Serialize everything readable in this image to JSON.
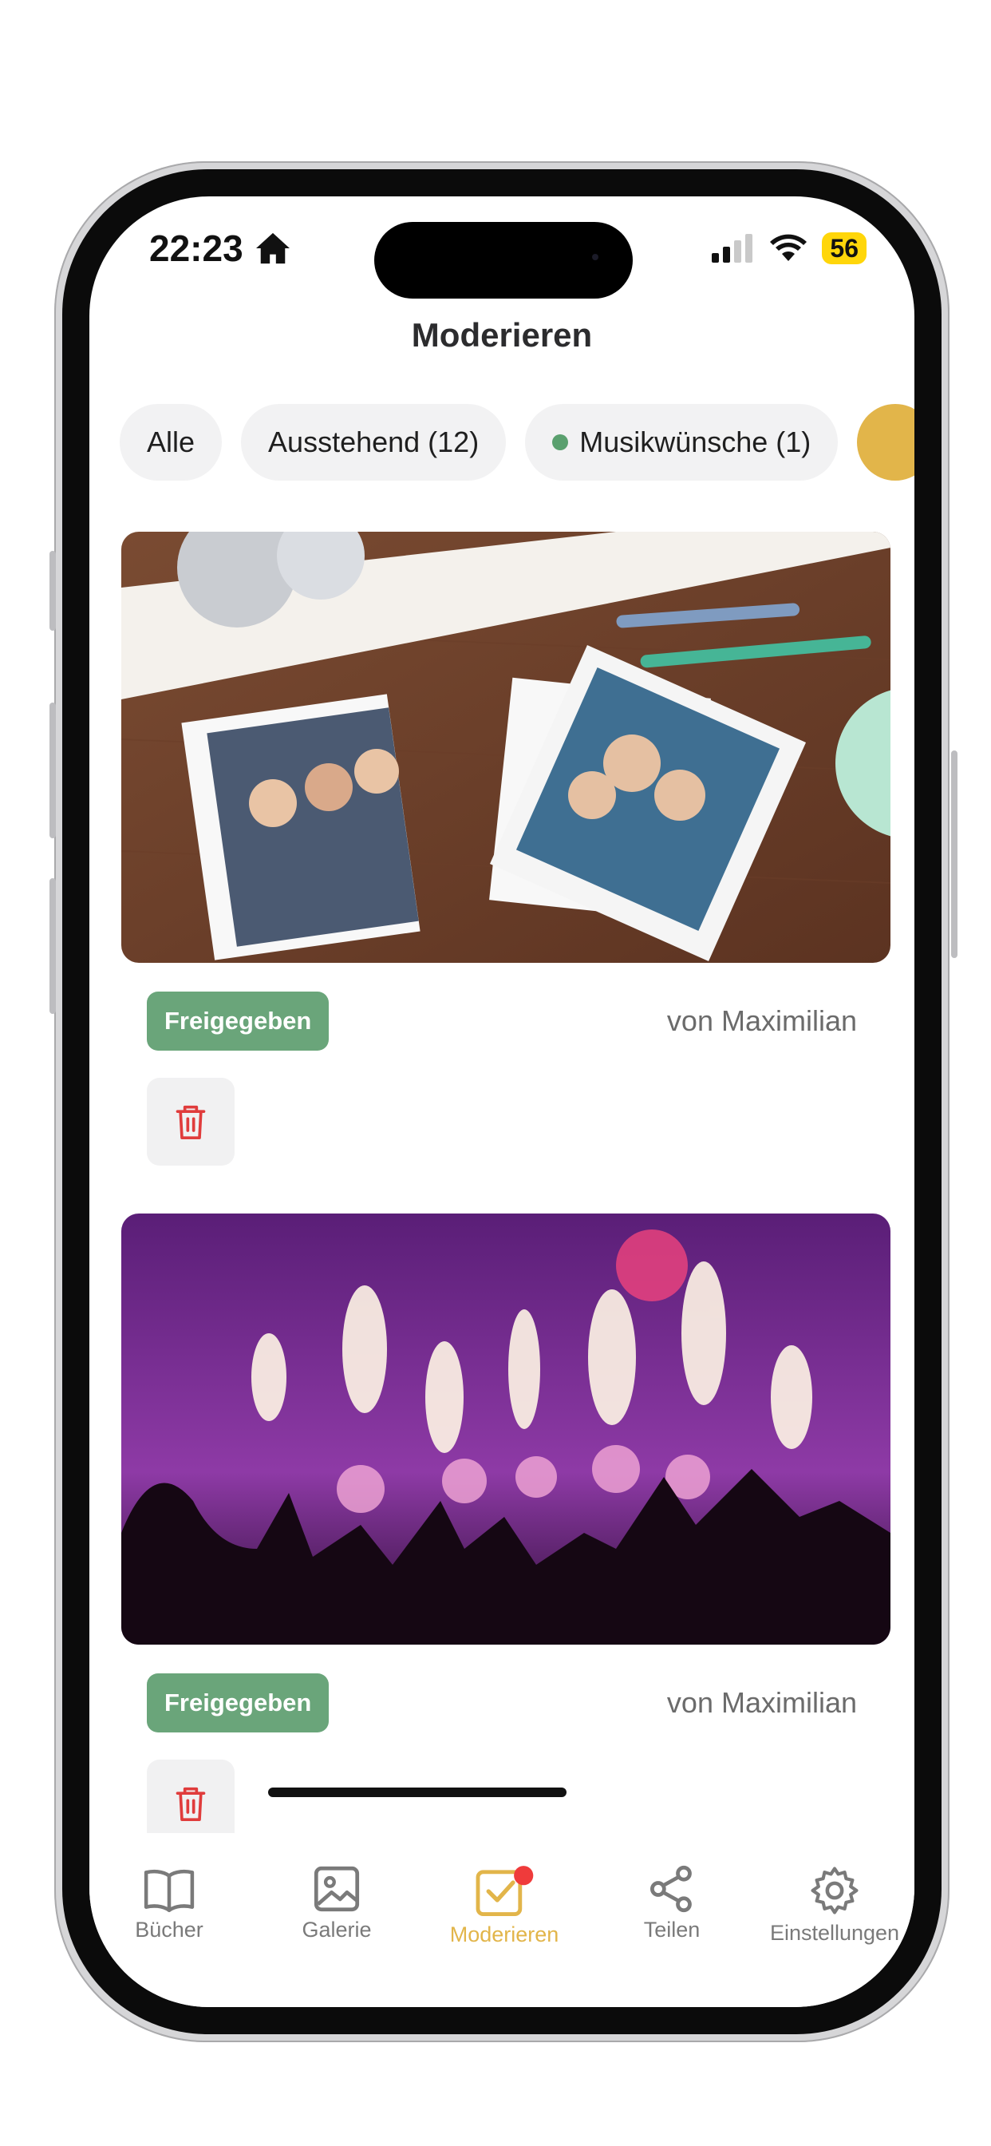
{
  "status_bar": {
    "time": "22:23",
    "battery": "56"
  },
  "header": {
    "title": "Moderieren"
  },
  "filters": [
    {
      "label": "Alle"
    },
    {
      "label": "Ausstehend (12)"
    },
    {
      "label": "Musikwünsche (1)"
    }
  ],
  "cards": [
    {
      "status": "Freigegeben",
      "author": "von Maximilian",
      "image": "birthday-photos-image"
    },
    {
      "status": "Freigegeben",
      "author": "von Maximilian",
      "image": "concert-fireworks-image"
    }
  ],
  "tabbar": {
    "items": [
      {
        "label": "Bücher",
        "icon": "book-icon"
      },
      {
        "label": "Galerie",
        "icon": "gallery-icon"
      },
      {
        "label": "Moderieren",
        "icon": "moderate-icon",
        "active": true
      },
      {
        "label": "Teilen",
        "icon": "share-icon"
      },
      {
        "label": "Einstellungen",
        "icon": "gear-icon"
      }
    ]
  },
  "colors": {
    "accent": "#e2b54a",
    "approved": "#6aa57a",
    "delete": "#e03c3c",
    "notification": "#ef3b3b",
    "music_dot": "#5aa06e"
  }
}
